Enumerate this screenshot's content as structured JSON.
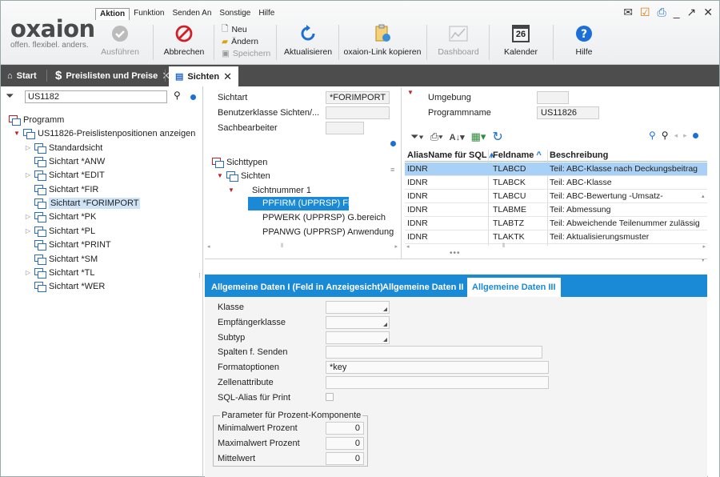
{
  "menu": [
    "Aktion",
    "Funktion",
    "Senden An",
    "Sonstige",
    "Hilfe"
  ],
  "logo": {
    "brand": "oxaion",
    "tagline": "offen. flexibel. anders."
  },
  "ribbon": {
    "ausfuehren": "Ausführen",
    "abbrechen": "Abbrechen",
    "neu": "Neu",
    "aendern": "Ändern",
    "speichern": "Speichern",
    "aktualisieren": "Aktualisieren",
    "oxaion_link": "oxaion-Link kopieren",
    "dashboard": "Dashboard",
    "kalender": "Kalender",
    "kalender_day": "26",
    "hilfe": "Hilfe"
  },
  "tabs": {
    "start": "Start",
    "preislisten": "Preislisten und Preise",
    "sichten": "Sichten"
  },
  "left": {
    "search_value": "US1182",
    "tree": [
      {
        "label": "Programm"
      },
      {
        "label": "US11826-Preislistenpositionen anzeigen"
      },
      {
        "label": "Standardsicht"
      },
      {
        "label": "Sichtart *ANW"
      },
      {
        "label": "Sichtart *EDIT"
      },
      {
        "label": "Sichtart *FIR"
      },
      {
        "label": "Sichtart *FORIMPORT"
      },
      {
        "label": "Sichtart *PK"
      },
      {
        "label": "Sichtart *PL"
      },
      {
        "label": "Sichtart *PRINT"
      },
      {
        "label": "Sichtart *SM"
      },
      {
        "label": "Sichtart *TL"
      },
      {
        "label": "Sichtart *WER"
      }
    ]
  },
  "center": {
    "sichtart_label": "Sichtart",
    "sichtart_value": "*FORIMPORT",
    "benutzerklasse_label": "Benutzerklasse Sichten/...",
    "sachbearbeiter_label": "Sachbearbeiter",
    "tree": {
      "sichttypen": "Sichttypen",
      "sichten": "Sichten",
      "sichtnummer": "Sichtnummer 1",
      "items": [
        "PPFIRM (UPPRSP) Firma",
        "PPWERK (UPPRSP) G.bereich",
        "PPANWG (UPPRSP) Anwendung"
      ]
    }
  },
  "right": {
    "umgebung_label": "Umgebung",
    "programmname_label": "Programmname",
    "programmname_value": "US11826",
    "grid": {
      "headers": [
        "AliasName für SQL",
        "Feldname",
        "Beschreibung"
      ],
      "rows": [
        [
          "IDNR",
          "TLABCD",
          "Teil: ABC-Klasse nach Deckungsbeitrag"
        ],
        [
          "IDNR",
          "TLABCK",
          "Teil: ABC-Klasse"
        ],
        [
          "IDNR",
          "TLABCU",
          "Teil: ABC-Bewertung -Umsatz-"
        ],
        [
          "IDNR",
          "TLABME",
          "Teil: Abmessung"
        ],
        [
          "IDNR",
          "TLABTZ",
          "Teil: Abweichende Teilenummer zulässig"
        ],
        [
          "IDNR",
          "TLAKTK",
          "Teil: Aktualisierungsmuster"
        ]
      ]
    }
  },
  "bottom": {
    "tabs": [
      "Allgemeine Daten I (Feld in Anzeigesicht)",
      "Allgemeine Daten II",
      "Allgemeine Daten III"
    ],
    "klasse": "Klasse",
    "empfaengerklasse": "Empfängerklasse",
    "subtyp": "Subtyp",
    "spalten": "Spalten f. Senden",
    "formatoptionen": "Formatoptionen",
    "formatoptionen_value": "*key",
    "zellenattribute": "Zellenattribute",
    "sql_alias": "SQL-Alias für Print",
    "group_title": "Parameter für Prozent-Komponente",
    "min_label": "Minimalwert Prozent",
    "min_value": "0",
    "max_label": "Maximalwert Prozent",
    "max_value": "0",
    "mittel_label": "Mittelwert",
    "mittel_value": "0"
  },
  "colors": {
    "accent": "#1b8ad6",
    "tabbar": "#4d4d4d",
    "selection": "#a9d1f5"
  }
}
